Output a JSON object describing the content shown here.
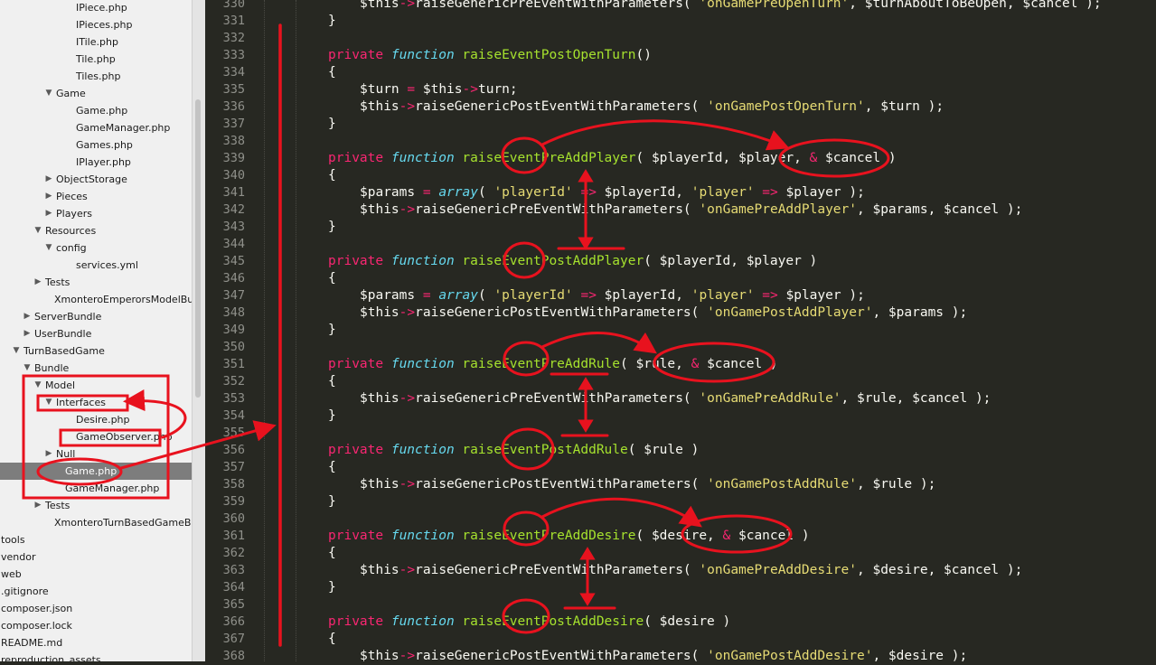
{
  "sidebar": {
    "items": [
      {
        "label": "IPiece.php",
        "type": "file",
        "indent": 5
      },
      {
        "label": "IPieces.php",
        "type": "file",
        "indent": 5
      },
      {
        "label": "ITile.php",
        "type": "file",
        "indent": 5
      },
      {
        "label": "Tile.php",
        "type": "file",
        "indent": 5
      },
      {
        "label": "Tiles.php",
        "type": "file",
        "indent": 5
      },
      {
        "label": "Game",
        "type": "folder-open",
        "indent": 4
      },
      {
        "label": "Game.php",
        "type": "file",
        "indent": 5
      },
      {
        "label": "GameManager.php",
        "type": "file",
        "indent": 5
      },
      {
        "label": "Games.php",
        "type": "file",
        "indent": 5
      },
      {
        "label": "IPlayer.php",
        "type": "file",
        "indent": 5
      },
      {
        "label": "ObjectStorage",
        "type": "folder-closed",
        "indent": 4
      },
      {
        "label": "Pieces",
        "type": "folder-closed",
        "indent": 4
      },
      {
        "label": "Players",
        "type": "folder-closed",
        "indent": 4
      },
      {
        "label": "Resources",
        "type": "folder-open",
        "indent": 3
      },
      {
        "label": "config",
        "type": "folder-open",
        "indent": 4
      },
      {
        "label": "services.yml",
        "type": "file",
        "indent": 5
      },
      {
        "label": "Tests",
        "type": "folder-closed",
        "indent": 3
      },
      {
        "label": "XmonteroEmperorsModelBundl",
        "type": "file",
        "indent": 3
      },
      {
        "label": "ServerBundle",
        "type": "folder-closed",
        "indent": 2
      },
      {
        "label": "UserBundle",
        "type": "folder-closed",
        "indent": 2
      },
      {
        "label": "TurnBasedGame",
        "type": "folder-open",
        "indent": 1
      },
      {
        "label": "Bundle",
        "type": "folder-open",
        "indent": 2
      },
      {
        "label": "Model",
        "type": "folder-open",
        "indent": 3
      },
      {
        "label": "Interfaces",
        "type": "folder-open",
        "indent": 4
      },
      {
        "label": "Desire.php",
        "type": "file",
        "indent": 5
      },
      {
        "label": "GameObserver.php",
        "type": "file",
        "indent": 5
      },
      {
        "label": "Null",
        "type": "folder-closed",
        "indent": 4
      },
      {
        "label": "Game.php",
        "type": "file",
        "indent": 4,
        "selected": true
      },
      {
        "label": "GameManager.php",
        "type": "file",
        "indent": 4
      },
      {
        "label": "Tests",
        "type": "folder-closed",
        "indent": 3
      },
      {
        "label": "XmonteroTurnBasedGameBundl",
        "type": "file",
        "indent": 3
      },
      {
        "label": "tools",
        "type": "file",
        "indent": 0
      },
      {
        "label": "vendor",
        "type": "file",
        "indent": 0
      },
      {
        "label": "web",
        "type": "file",
        "indent": 0
      },
      {
        "label": ".gitignore",
        "type": "file",
        "indent": 0
      },
      {
        "label": "composer.json",
        "type": "file",
        "indent": 0
      },
      {
        "label": "composer.lock",
        "type": "file",
        "indent": 0
      },
      {
        "label": "README.md",
        "type": "file",
        "indent": 0
      },
      {
        "label": "reproduction_assets",
        "type": "file",
        "indent": 0
      }
    ]
  },
  "editor": {
    "lines": [
      {
        "n": "330",
        "tokens": [
          [
            "i8",
            ""
          ],
          [
            "v",
            "$this"
          ],
          [
            "op",
            "->"
          ],
          [
            "p",
            "raiseGenericPreEventWithParameters( "
          ],
          [
            "s",
            "'onGamePreOpenTurn'"
          ],
          [
            "p",
            ", $turnAboutToBeOpen, $cancel );"
          ]
        ]
      },
      {
        "n": "331",
        "tokens": [
          [
            "i4",
            ""
          ],
          [
            "p",
            "}"
          ]
        ]
      },
      {
        "n": "332",
        "tokens": []
      },
      {
        "n": "333",
        "tokens": [
          [
            "i4",
            ""
          ],
          [
            "kw",
            "private"
          ],
          [
            "p",
            " "
          ],
          [
            "st",
            "function"
          ],
          [
            "p",
            " "
          ],
          [
            "fn",
            "raiseEventPostOpenTurn"
          ],
          [
            "p",
            "()"
          ]
        ]
      },
      {
        "n": "334",
        "tokens": [
          [
            "i4",
            ""
          ],
          [
            "p",
            "{"
          ]
        ]
      },
      {
        "n": "335",
        "tokens": [
          [
            "i8",
            ""
          ],
          [
            "p",
            "$turn "
          ],
          [
            "op",
            "="
          ],
          [
            "p",
            " $this"
          ],
          [
            "op",
            "->"
          ],
          [
            "p",
            "turn;"
          ]
        ]
      },
      {
        "n": "336",
        "tokens": [
          [
            "i8",
            ""
          ],
          [
            "p",
            "$this"
          ],
          [
            "op",
            "->"
          ],
          [
            "p",
            "raiseGenericPostEventWithParameters( "
          ],
          [
            "s",
            "'onGamePostOpenTurn'"
          ],
          [
            "p",
            ", $turn );"
          ]
        ]
      },
      {
        "n": "337",
        "tokens": [
          [
            "i4",
            ""
          ],
          [
            "p",
            "}"
          ]
        ]
      },
      {
        "n": "338",
        "tokens": []
      },
      {
        "n": "339",
        "tokens": [
          [
            "i4",
            ""
          ],
          [
            "kw",
            "private"
          ],
          [
            "p",
            " "
          ],
          [
            "st",
            "function"
          ],
          [
            "p",
            " "
          ],
          [
            "fn",
            "raiseEventPreAddPlayer"
          ],
          [
            "p",
            "( $playerId, $player, "
          ],
          [
            "op",
            "&"
          ],
          [
            "p",
            " $cancel )"
          ]
        ]
      },
      {
        "n": "340",
        "tokens": [
          [
            "i4",
            ""
          ],
          [
            "p",
            "{"
          ]
        ]
      },
      {
        "n": "341",
        "tokens": [
          [
            "i8",
            ""
          ],
          [
            "p",
            "$params "
          ],
          [
            "op",
            "="
          ],
          [
            "p",
            " "
          ],
          [
            "st",
            "array"
          ],
          [
            "p",
            "( "
          ],
          [
            "s",
            "'playerId'"
          ],
          [
            "p",
            " "
          ],
          [
            "op",
            "=>"
          ],
          [
            "p",
            " $playerId, "
          ],
          [
            "s",
            "'player'"
          ],
          [
            "p",
            " "
          ],
          [
            "op",
            "=>"
          ],
          [
            "p",
            " $player );"
          ]
        ]
      },
      {
        "n": "342",
        "tokens": [
          [
            "i8",
            ""
          ],
          [
            "p",
            "$this"
          ],
          [
            "op",
            "->"
          ],
          [
            "p",
            "raiseGenericPreEventWithParameters( "
          ],
          [
            "s",
            "'onGamePreAddPlayer'"
          ],
          [
            "p",
            ", $params, $cancel );"
          ]
        ]
      },
      {
        "n": "343",
        "tokens": [
          [
            "i4",
            ""
          ],
          [
            "p",
            "}"
          ]
        ]
      },
      {
        "n": "344",
        "tokens": []
      },
      {
        "n": "345",
        "tokens": [
          [
            "i4",
            ""
          ],
          [
            "kw",
            "private"
          ],
          [
            "p",
            " "
          ],
          [
            "st",
            "function"
          ],
          [
            "p",
            " "
          ],
          [
            "fn",
            "raiseEventPostAddPlayer"
          ],
          [
            "p",
            "( $playerId, $player )"
          ]
        ]
      },
      {
        "n": "346",
        "tokens": [
          [
            "i4",
            ""
          ],
          [
            "p",
            "{"
          ]
        ]
      },
      {
        "n": "347",
        "tokens": [
          [
            "i8",
            ""
          ],
          [
            "p",
            "$params "
          ],
          [
            "op",
            "="
          ],
          [
            "p",
            " "
          ],
          [
            "st",
            "array"
          ],
          [
            "p",
            "( "
          ],
          [
            "s",
            "'playerId'"
          ],
          [
            "p",
            " "
          ],
          [
            "op",
            "=>"
          ],
          [
            "p",
            " $playerId, "
          ],
          [
            "s",
            "'player'"
          ],
          [
            "p",
            " "
          ],
          [
            "op",
            "=>"
          ],
          [
            "p",
            " $player );"
          ]
        ]
      },
      {
        "n": "348",
        "tokens": [
          [
            "i8",
            ""
          ],
          [
            "p",
            "$this"
          ],
          [
            "op",
            "->"
          ],
          [
            "p",
            "raiseGenericPostEventWithParameters( "
          ],
          [
            "s",
            "'onGamePostAddPlayer'"
          ],
          [
            "p",
            ", $params );"
          ]
        ]
      },
      {
        "n": "349",
        "tokens": [
          [
            "i4",
            ""
          ],
          [
            "p",
            "}"
          ]
        ]
      },
      {
        "n": "350",
        "tokens": []
      },
      {
        "n": "351",
        "tokens": [
          [
            "i4",
            ""
          ],
          [
            "kw",
            "private"
          ],
          [
            "p",
            " "
          ],
          [
            "st",
            "function"
          ],
          [
            "p",
            " "
          ],
          [
            "fn",
            "raiseEventPreAddRule"
          ],
          [
            "p",
            "( $rule, "
          ],
          [
            "op",
            "&"
          ],
          [
            "p",
            " $cancel )"
          ]
        ]
      },
      {
        "n": "352",
        "tokens": [
          [
            "i4",
            ""
          ],
          [
            "p",
            "{"
          ]
        ]
      },
      {
        "n": "353",
        "tokens": [
          [
            "i8",
            ""
          ],
          [
            "p",
            "$this"
          ],
          [
            "op",
            "->"
          ],
          [
            "p",
            "raiseGenericPreEventWithParameters( "
          ],
          [
            "s",
            "'onGamePreAddRule'"
          ],
          [
            "p",
            ", $rule, $cancel );"
          ]
        ]
      },
      {
        "n": "354",
        "tokens": [
          [
            "i4",
            ""
          ],
          [
            "p",
            "}"
          ]
        ]
      },
      {
        "n": "355",
        "tokens": []
      },
      {
        "n": "356",
        "tokens": [
          [
            "i4",
            ""
          ],
          [
            "kw",
            "private"
          ],
          [
            "p",
            " "
          ],
          [
            "st",
            "function"
          ],
          [
            "p",
            " "
          ],
          [
            "fn",
            "raiseEventPostAddRule"
          ],
          [
            "p",
            "( $rule )"
          ]
        ]
      },
      {
        "n": "357",
        "tokens": [
          [
            "i4",
            ""
          ],
          [
            "p",
            "{"
          ]
        ]
      },
      {
        "n": "358",
        "tokens": [
          [
            "i8",
            ""
          ],
          [
            "p",
            "$this"
          ],
          [
            "op",
            "->"
          ],
          [
            "p",
            "raiseGenericPostEventWithParameters( "
          ],
          [
            "s",
            "'onGamePostAddRule'"
          ],
          [
            "p",
            ", $rule );"
          ]
        ]
      },
      {
        "n": "359",
        "tokens": [
          [
            "i4",
            ""
          ],
          [
            "p",
            "}"
          ]
        ]
      },
      {
        "n": "360",
        "tokens": []
      },
      {
        "n": "361",
        "tokens": [
          [
            "i4",
            ""
          ],
          [
            "kw",
            "private"
          ],
          [
            "p",
            " "
          ],
          [
            "st",
            "function"
          ],
          [
            "p",
            " "
          ],
          [
            "fn",
            "raiseEventPreAddDesire"
          ],
          [
            "p",
            "( $desire, "
          ],
          [
            "op",
            "&"
          ],
          [
            "p",
            " $cancel )"
          ]
        ]
      },
      {
        "n": "362",
        "tokens": [
          [
            "i4",
            ""
          ],
          [
            "p",
            "{"
          ]
        ]
      },
      {
        "n": "363",
        "tokens": [
          [
            "i8",
            ""
          ],
          [
            "p",
            "$this"
          ],
          [
            "op",
            "->"
          ],
          [
            "p",
            "raiseGenericPreEventWithParameters( "
          ],
          [
            "s",
            "'onGamePreAddDesire'"
          ],
          [
            "p",
            ", $desire, $cancel );"
          ]
        ]
      },
      {
        "n": "364",
        "tokens": [
          [
            "i4",
            ""
          ],
          [
            "p",
            "}"
          ]
        ]
      },
      {
        "n": "365",
        "tokens": []
      },
      {
        "n": "366",
        "tokens": [
          [
            "i4",
            ""
          ],
          [
            "kw",
            "private"
          ],
          [
            "p",
            " "
          ],
          [
            "st",
            "function"
          ],
          [
            "p",
            " "
          ],
          [
            "fn",
            "raiseEventPostAddDesire"
          ],
          [
            "p",
            "( $desire )"
          ]
        ]
      },
      {
        "n": "367",
        "tokens": [
          [
            "i4",
            ""
          ],
          [
            "p",
            "{"
          ]
        ]
      },
      {
        "n": "368",
        "tokens": [
          [
            "i8",
            ""
          ],
          [
            "p",
            "$this"
          ],
          [
            "op",
            "->"
          ],
          [
            "p",
            "raiseGenericPostEventWithParameters( "
          ],
          [
            "s",
            "'onGamePostAddDesire'"
          ],
          [
            "p",
            ", $desire );"
          ]
        ]
      }
    ]
  },
  "colors": {
    "editor_bg": "#272822",
    "keyword": "#f92672",
    "storage": "#66d9ef",
    "function_name": "#a6e22e",
    "string": "#e6db74",
    "plain": "#f8f8f2",
    "line_number": "#8f908a",
    "sidebar_bg": "#f0f0f0",
    "selection_bg": "#7d7d7d",
    "annotation": "#e8121e"
  }
}
